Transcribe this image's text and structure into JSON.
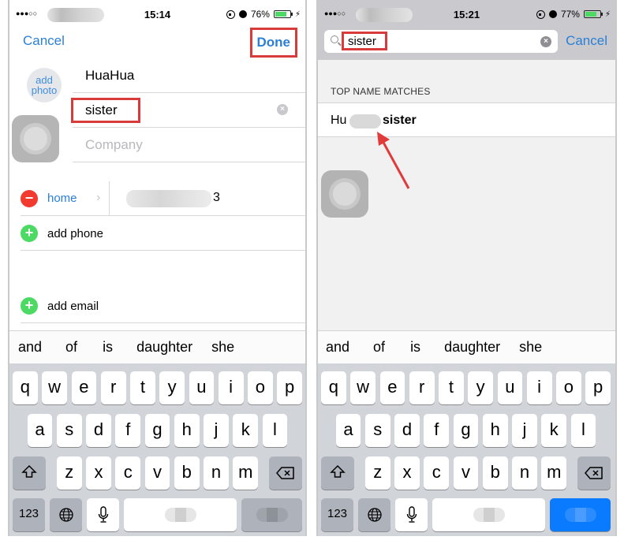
{
  "left": {
    "status": {
      "signal": "●●●○○",
      "time": "15:14",
      "battery": "76%",
      "battery_level": 0.76
    },
    "nav": {
      "cancel": "Cancel",
      "done": "Done"
    },
    "add_photo": {
      "line1": "add",
      "line2": "photo"
    },
    "fields": {
      "first": "HuaHua",
      "last": "sister",
      "company_placeholder": "Company"
    },
    "phone_row": {
      "label": "home",
      "number_tail": "3"
    },
    "add_phone": "add phone",
    "add_email": "add email"
  },
  "right": {
    "status": {
      "signal": "●●●○○",
      "time": "15:21",
      "battery": "77%",
      "battery_level": 0.77
    },
    "search": {
      "value": "sister",
      "cancel": "Cancel"
    },
    "section_header": "TOP NAME MATCHES",
    "match": {
      "prefix": "Hu",
      "suffix": "sister"
    }
  },
  "suggestions": [
    "and",
    "of",
    "is",
    "daughter",
    "she"
  ],
  "keyboard": {
    "row1": [
      "q",
      "w",
      "e",
      "r",
      "t",
      "y",
      "u",
      "i",
      "o",
      "p"
    ],
    "row2": [
      "a",
      "s",
      "d",
      "f",
      "g",
      "h",
      "j",
      "k",
      "l"
    ],
    "row3": [
      "z",
      "x",
      "c",
      "v",
      "b",
      "n",
      "m"
    ],
    "numbers_key": "123"
  },
  "colors": {
    "accent": "#2b7fd6",
    "highlight": "#d93a3a",
    "delete": "#f23a2f",
    "add": "#4cd964",
    "search_key": "#0a7aff"
  }
}
